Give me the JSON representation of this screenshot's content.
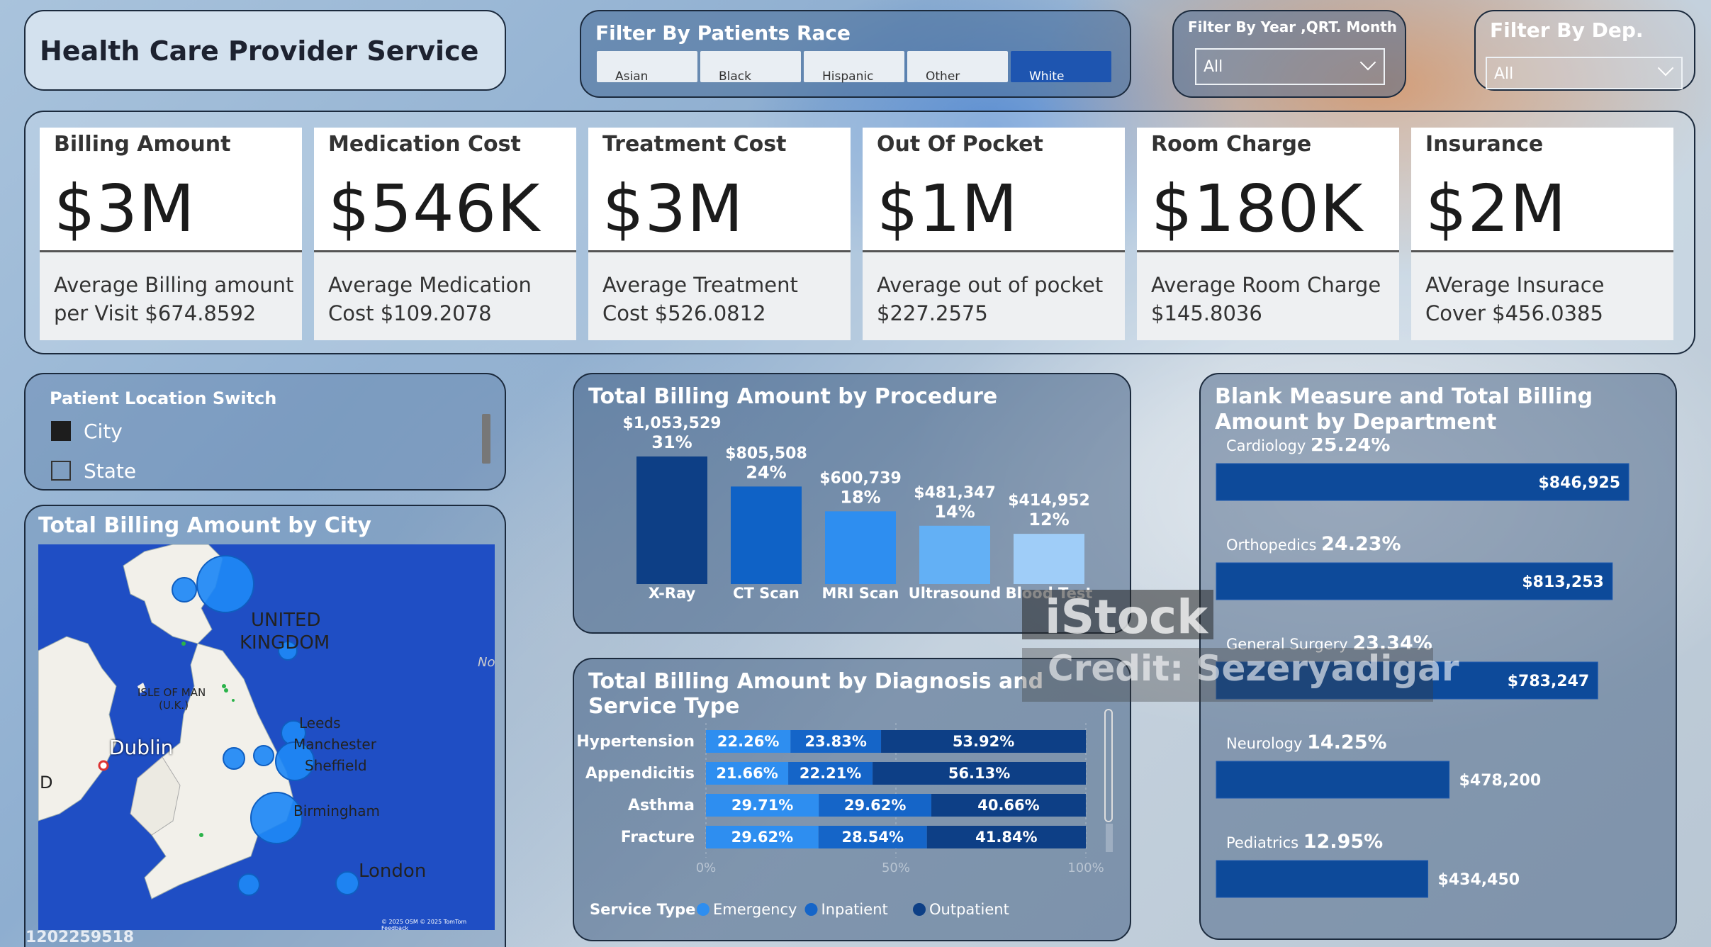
{
  "title": "Health Care Provider Service",
  "race_filter": {
    "label": "Filter By Patients Race",
    "options": [
      "Asian",
      "Black",
      "Hispanic",
      "Other",
      "White"
    ],
    "selected": "White"
  },
  "year_filter": {
    "label": "Filter By Year ,QRT. Month",
    "value": "All"
  },
  "dep_filter": {
    "label": "Filter By Dep.",
    "value": "All"
  },
  "kpis": [
    {
      "name": "Billing Amount",
      "value": "$3M",
      "avg": "Average Billing amount per Visit $674.8592"
    },
    {
      "name": "Medication Cost",
      "value": "$546K",
      "avg": "Average Medication Cost $109.2078"
    },
    {
      "name": "Treatment Cost",
      "value": "$3M",
      "avg": "Average Treatment Cost $526.0812"
    },
    {
      "name": "Out Of Pocket",
      "value": "$1M",
      "avg": "Average out of pocket $227.2575"
    },
    {
      "name": "Room Charge",
      "value": "$180K",
      "avg": "Average Room Charge $145.8036"
    },
    {
      "name": "Insurance",
      "value": "$2M",
      "avg": "AVerage Insurace Cover $456.0385"
    }
  ],
  "location_switch": {
    "label": "Patient Location Switch",
    "options": [
      "City",
      "State"
    ],
    "selected": "City"
  },
  "map": {
    "title": "Total Billing Amount by City",
    "labels": [
      "UNITED",
      "KINGDOM",
      "ISLE OF MAN",
      "(U.K.)",
      "Dublin",
      "Leeds",
      "Manchester",
      "Sheffield",
      "Birmingham",
      "London",
      "D",
      "No"
    ],
    "credit": "© 2025 OSM © 2025 TomTom Feedback",
    "bubbles_relative_billing": [
      1.0,
      0.35,
      0.3,
      0.35,
      0.3,
      0.55,
      0.9,
      0.3,
      0.3,
      0.25,
      0.25
    ]
  },
  "procedure_chart": {
    "title": "Total Billing Amount by Procedure",
    "chart_data": {
      "type": "bar",
      "categories": [
        "X-Ray",
        "CT Scan",
        "MRI Scan",
        "Ultrasound",
        "Blood Test"
      ],
      "values": [
        1053529,
        805508,
        600739,
        481347,
        414952
      ],
      "value_labels": [
        "$1,053,529",
        "$805,508",
        "$600,739",
        "$481,347",
        "$414,952"
      ],
      "percent_labels": [
        "31%",
        "24%",
        "18%",
        "14%",
        "12%"
      ],
      "colors": [
        "#0d3f86",
        "#0f62c6",
        "#2e8ef0",
        "#63b0f5",
        "#9fcdf8"
      ]
    }
  },
  "diagnosis_chart": {
    "title": "Total Billing Amount by Diagnosis and Service Type",
    "chart_data": {
      "type": "bar",
      "stacked": "100%",
      "categories": [
        "Hypertension",
        "Appendicitis",
        "Asthma",
        "Fracture"
      ],
      "series": [
        {
          "name": "Emergency",
          "values": [
            22.26,
            21.66,
            29.71,
            29.62
          ],
          "color": "#2e8ef0"
        },
        {
          "name": "Inpatient",
          "values": [
            23.83,
            22.21,
            29.62,
            28.54
          ],
          "color": "#1565c8"
        },
        {
          "name": "Outpatient",
          "values": [
            53.92,
            56.13,
            40.66,
            41.84
          ],
          "color": "#0d3f86"
        }
      ],
      "x_ticks": [
        "0%",
        "50%",
        "100%"
      ],
      "legend_title": "Service Type"
    }
  },
  "department_chart": {
    "title": "Blank Measure and Total Billing Amount by Department",
    "chart_data": {
      "type": "bar",
      "categories": [
        "Cardiology",
        "Orthopedics",
        "General Surgery",
        "Neurology",
        "Pediatrics"
      ],
      "percent_labels": [
        "25.24%",
        "24.23%",
        "23.34%",
        "14.25%",
        "12.95%"
      ],
      "values": [
        846925,
        813253,
        783247,
        478200,
        434450
      ],
      "value_labels": [
        "$846,925",
        "$813,253",
        "$783,247",
        "$478,200",
        "$434,450"
      ],
      "color": "#0d4a9a"
    }
  },
  "watermark": {
    "brand": "iStock",
    "credit": "Credit: Sezeryadigar",
    "id": "1202259518"
  }
}
